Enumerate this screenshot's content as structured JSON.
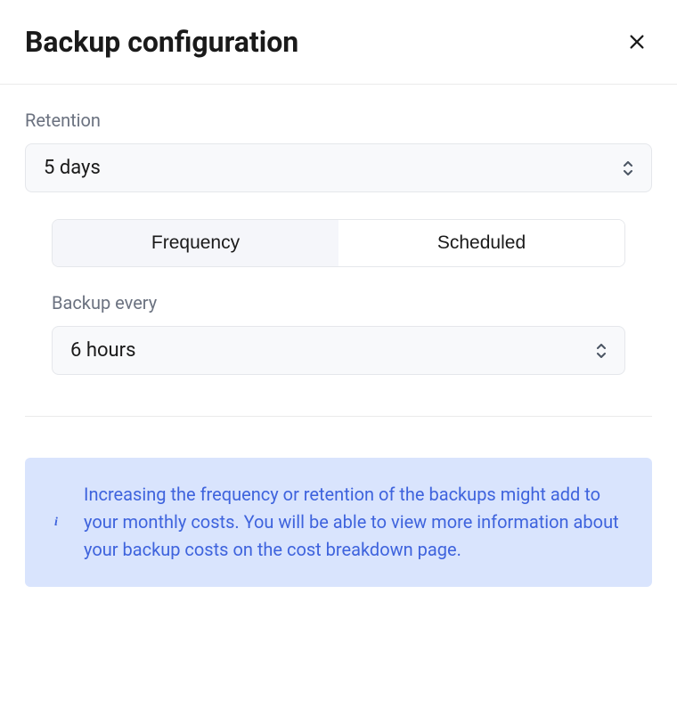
{
  "header": {
    "title": "Backup configuration"
  },
  "retention": {
    "label": "Retention",
    "value": "5 days"
  },
  "tabs": {
    "frequency": "Frequency",
    "scheduled": "Scheduled"
  },
  "backup_every": {
    "label": "Backup every",
    "value": "6 hours"
  },
  "info": {
    "text": "Increasing the frequency or retention of the backups might add to your monthly costs. You will be able to view more information about your backup costs on the cost breakdown page."
  }
}
